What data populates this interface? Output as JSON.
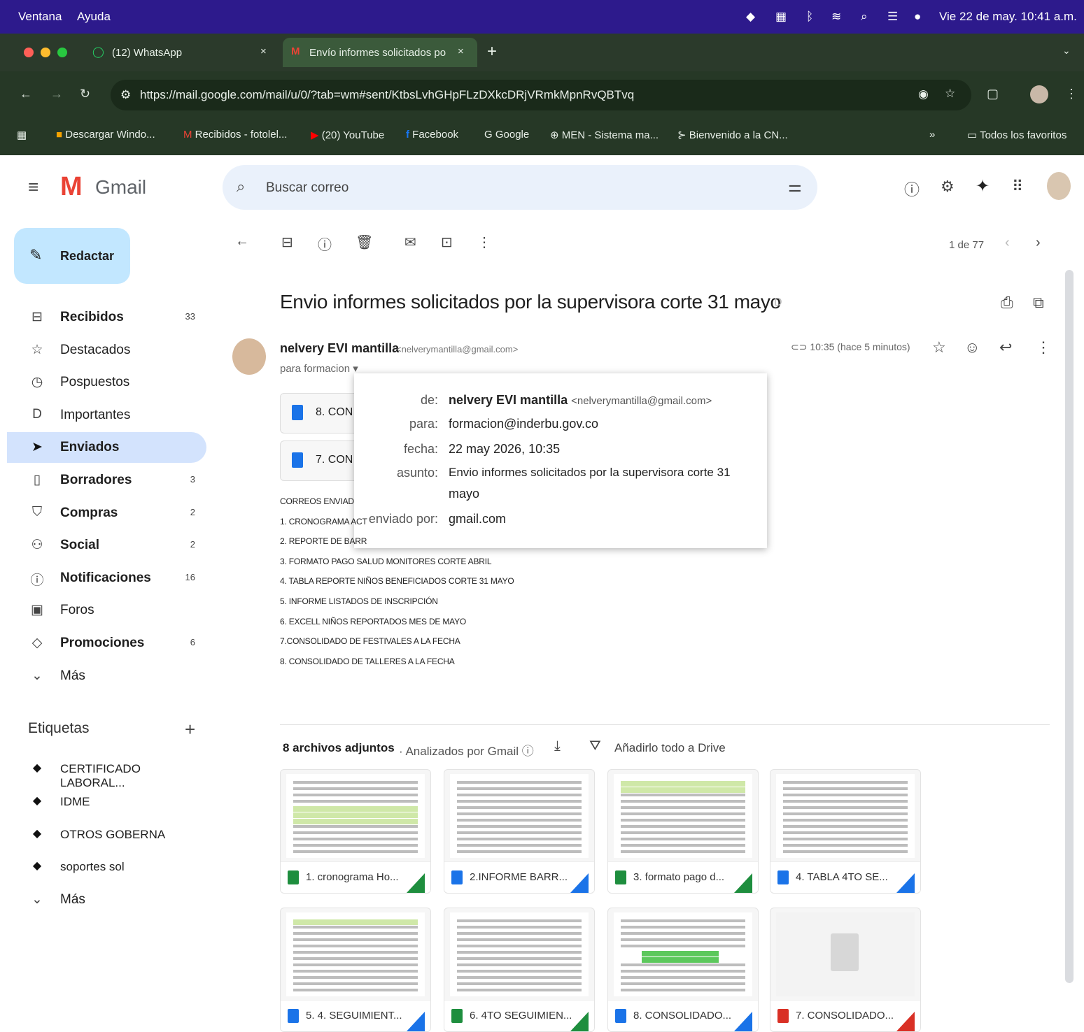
{
  "menubar": {
    "items": [
      "Ventana",
      "Ayuda"
    ],
    "datetime": "Vie 22 de may.  10:41 a.m."
  },
  "tabs": [
    {
      "title": "(12) WhatsApp"
    },
    {
      "title": "Envío informes solicitados po"
    }
  ],
  "address": {
    "url": "https://mail.google.com/mail/u/0/?tab=wm#sent/KtbsLvhGHpFLzDXkcDRjVRmkMpnRvQBTvq"
  },
  "bookmarks": [
    "Descargar Windo...",
    "Recibidos - fotolel...",
    "(20) YouTube",
    "Facebook",
    "Google",
    "MEN - Sistema ma...",
    "Bienvenido a la CN..."
  ],
  "bookmarks_more": "»",
  "bookmarks_all": "Todos los favoritos",
  "gmail": {
    "logo_text": "Gmail",
    "search_placeholder": "Buscar correo",
    "compose": "Redactar",
    "sidebar": [
      {
        "label": "Recibidos",
        "count": "33",
        "icon": "inbox-icon",
        "bold": true
      },
      {
        "label": "Destacados",
        "count": "",
        "icon": "star-icon",
        "bold": false
      },
      {
        "label": "Pospuestos",
        "count": "",
        "icon": "clock-icon",
        "bold": false
      },
      {
        "label": "Importantes",
        "count": "",
        "icon": "important-icon",
        "bold": false
      },
      {
        "label": "Enviados",
        "count": "",
        "icon": "send-icon",
        "bold": true,
        "active": true
      },
      {
        "label": "Borradores",
        "count": "3",
        "icon": "draft-icon",
        "bold": true
      },
      {
        "label": "Compras",
        "count": "2",
        "icon": "shopping-icon",
        "bold": true
      },
      {
        "label": "Social",
        "count": "2",
        "icon": "social-icon",
        "bold": true
      },
      {
        "label": "Notificaciones",
        "count": "16",
        "icon": "info-icon",
        "bold": true
      },
      {
        "label": "Foros",
        "count": "",
        "icon": "forum-icon",
        "bold": false
      },
      {
        "label": "Promociones",
        "count": "6",
        "icon": "tag-icon",
        "bold": true
      },
      {
        "label": "Más",
        "count": "",
        "icon": "chevron-down-icon",
        "bold": false
      }
    ],
    "labels_title": "Etiquetas",
    "labels": [
      "CERTIFICADO LABORAL...",
      "IDME",
      "OTROS GOBERNA",
      "soportes sol"
    ],
    "labels_more": "Más",
    "pager": "1 de 77",
    "subject": "Envio informes solicitados por la supervisora corte 31 mayo",
    "sender_name": "nelvery EVI mantilla",
    "sender_email": "<nelverymantilla@gmail.com>",
    "to_line": "para formacion",
    "time": "10:35 (hace 5 minutos)",
    "inline_attachments": [
      "8. CON",
      "7. CON"
    ],
    "body_lines": [
      "CORREOS ENVIAD",
      "1. CRONOGRAMA ACT",
      "2. REPORTE DE BARR",
      "3. FORMATO PAGO SALUD MONITORES  CORTE ABRIL",
      "4. TABLA REPORTE NIÑOS BENEFICIADOS  CORTE 31 MAYO",
      "5. INFORME LISTADOS DE INSCRIPCIÓN",
      "6. EXCELL NIÑOS REPORTADOS MES DE MAYO",
      "7.CONSOLIDADO DE FESTIVALES A LA FECHA",
      "8. CONSOLIDADO DE TALLERES A LA FECHA"
    ],
    "details": {
      "de_label": "de:",
      "de_name": "nelvery EVI mantilla",
      "de_email": "<nelverymantilla@gmail.com>",
      "para_label": "para:",
      "para_value": "formacion@inderbu.gov.co",
      "fecha_label": "fecha:",
      "fecha_value": "22 may 2026, 10:35",
      "asunto_label": "asunto:",
      "asunto_value_1": "Envio informes solicitados por la supervisora corte 31",
      "asunto_value_2": "mayo",
      "enviado_label": "enviado por:",
      "enviado_value": "gmail.com"
    },
    "attachments_header": {
      "count": "8 archivos adjuntos",
      "scanned": "Analizados por Gmail",
      "drive": "Añadirlo todo a Drive"
    },
    "attachments": [
      {
        "name": "1. cronograma Ho...",
        "color": "#1e8e3e"
      },
      {
        "name": "2.INFORME BARR...",
        "color": "#1a73e8"
      },
      {
        "name": "3. formato pago d...",
        "color": "#1e8e3e"
      },
      {
        "name": "4. TABLA 4TO SE...",
        "color": "#1a73e8"
      },
      {
        "name": "5. 4. SEGUIMIENT...",
        "color": "#1a73e8"
      },
      {
        "name": "6. 4TO SEGUIMIEN...",
        "color": "#1e8e3e"
      },
      {
        "name": "8. CONSOLIDADO...",
        "color": "#1a73e8"
      },
      {
        "name": "7. CONSOLIDADO...",
        "color": "#d93025"
      }
    ]
  },
  "colors": {
    "menubar": "#2d1a8c",
    "chrome": "#263826",
    "active_nav": "#d3e3fd",
    "compose": "#c2e7ff"
  }
}
